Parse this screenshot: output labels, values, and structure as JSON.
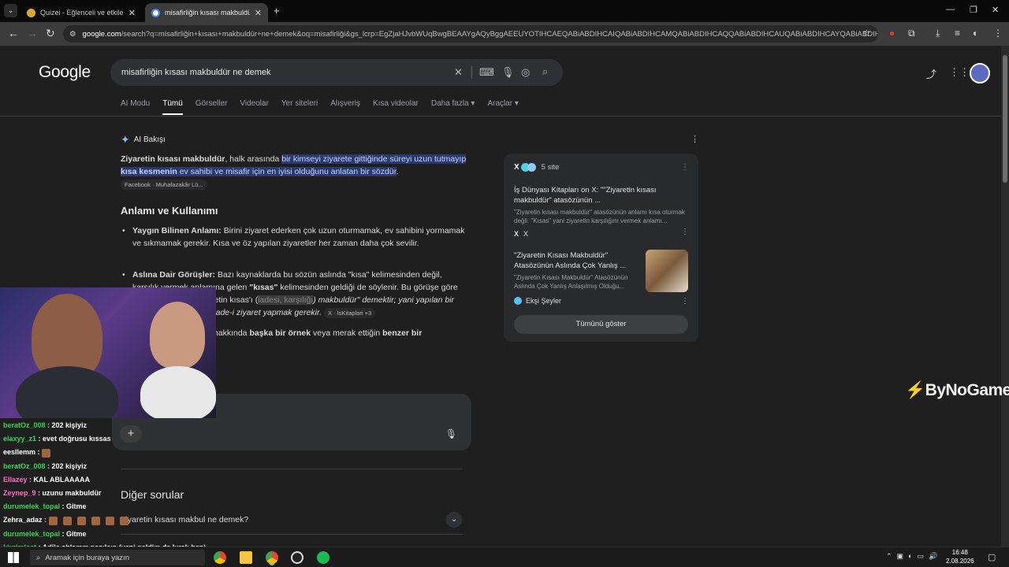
{
  "browser": {
    "tabs": [
      {
        "title": "Quizei - Eğlenceli ve etkileşimli"
      },
      {
        "title": "misafirliğin kısası makbuldür ne"
      }
    ],
    "url_host": "google.com",
    "url_path": "/search?q=misafirliğin+kısası+makbuldür+ne+demek&oq=misafirliği&gs_lcrp=EgZjaHJvbWUqBwgBEAAYgAQyBggAEEUYOTIHCAEQABiABDIHCAIQABiABDIHCAMQABiABDIHCAQQABiABDIHCAUQABiABDIHCAYQABiABDIHCA..."
  },
  "google": {
    "logo": "Google",
    "query": "misafirliğin kısası makbuldür ne demek",
    "tabs": [
      "AI Modu",
      "Tümü",
      "Görseller",
      "Videolar",
      "Yer siteleri",
      "Alışveriş",
      "Kısa videolar",
      "Daha fazla ▾",
      "Araçlar ▾"
    ],
    "ai_header": "AI Bakışı",
    "ai_intro_bold1": "Ziyaretin kısası makbuldür",
    "ai_intro_plain1": ", halk arasında ",
    "ai_intro_hl1": "bir kimseyi ziyarete gittiğinde süreyi uzun tutmayıp ",
    "ai_intro_bold2": "kısa kesmenin",
    "ai_intro_hl2": " ev sahibi ve misafir için en iyisi olduğunu anlatan bir sözdür",
    "ai_intro_end": ".",
    "ai_intro_chip": "Facebook · Muhafazakâr Lü...",
    "section_title": "Anlamı ve Kullanımı",
    "bullet1_bold": "Yaygın Bilinen Anlamı:",
    "bullet1_text": " Birini ziyaret ederken çok uzun oturmamak, ev sahibini yormamak ve sıkmamak gerekir. Kısa ve öz yapılan ziyaretler her zaman daha çok sevilir.",
    "bullet2_bold": "Aslına Dair Görüşler:",
    "bullet2_text1": " Bazı kaynaklarda bu sözün aslında \"kısa\" kelimesinden değil, karşılık vermek anlamına gelen ",
    "bullet2_bold2": "\"kısas\"",
    "bullet2_text2": " kelimesinden geldiği de söylenir. Bu görüşe göre atasözünün aslı \"Ziyaretin kısas'ı (",
    "bullet2_redacted": "iadesi, karşılığı",
    "bullet2_text3": ") makbuldür\" demektir; yani yapılan bir ziyaretin karşılık, yani iade-i ziyaret yapmak gerekir.",
    "bullet2_chip": "X · IsKitaplari +3",
    "para3_text1": "Bu atasözünün kullanımı hakkında ",
    "para3_bold1": "başka bir örnek",
    "para3_text2": " veya merak ettiğin ",
    "para3_bold2": "benzer bir",
    "other_questions_title": "Diğer sorular",
    "question1": "Ziyaretin kısası makbul ne demek?",
    "sources": {
      "count_label": "5 site",
      "items": [
        {
          "title": "İş Dünyası Kitapları on X: \"\"Ziyaretin kısası makbuldür\" atasözünün ...",
          "snippet": "\"Ziyaretin kısası makbuldür\" atasözünün anlamı kısa oturmak değil. \"Kısas\" yani ziyaretin karşılığını vermek anlamı...",
          "site": "X"
        },
        {
          "title": "\"Ziyaretin Kısası Makbuldür\" Atasözünün Aslında Çok Yanlış ...",
          "snippet": "\"Ziyaretin Kısası Makbuldür\" Atasözünün Aslında Çok Yanlış Anlaşılmış Olduğu...",
          "site": "Ekşi Şeyler"
        }
      ],
      "show_all": "Tümünü göster"
    }
  },
  "overlay": {
    "brand": "ByNoGame",
    "chat": [
      {
        "user": "beratOz_008",
        "color": "#39d353",
        "msg": "202 kişiyiz"
      },
      {
        "user": "elaxyy_z1",
        "color": "#39d353",
        "msg": "evet doğrusu kıssas"
      },
      {
        "user": "eesllemm",
        "color": "#ffffff",
        "msg": ""
      },
      {
        "user": "beratOz_008",
        "color": "#39d353",
        "msg": "202 kişiyiz"
      },
      {
        "user": "Ellazey",
        "color": "#ff6ec7",
        "msg": "KAL ABLAAAAA"
      },
      {
        "user": "Zeynep_9",
        "color": "#ff6ec7",
        "msg": "uzunu makbuldür"
      },
      {
        "user": "durumelek_topal",
        "color": "#39d353",
        "msg": "Gitme"
      },
      {
        "user": "Zehra_adaz",
        "color": "#ffffff",
        "msg": ""
      },
      {
        "user": "durumelek_topal",
        "color": "#39d353",
        "msg": "Gitme"
      },
      {
        "user": "kivrimleat",
        "color": "#39d353",
        "msg": "Adile ablamm nasılsın (yeni geldim de kırak ben)"
      }
    ]
  },
  "taskbar": {
    "search_placeholder": "Aramak için buraya yazın",
    "time": "16:48",
    "date": "2.08.2026"
  },
  "colors": {
    "accent_blue": "#8ab4f8",
    "brand_red": "#e53935"
  }
}
